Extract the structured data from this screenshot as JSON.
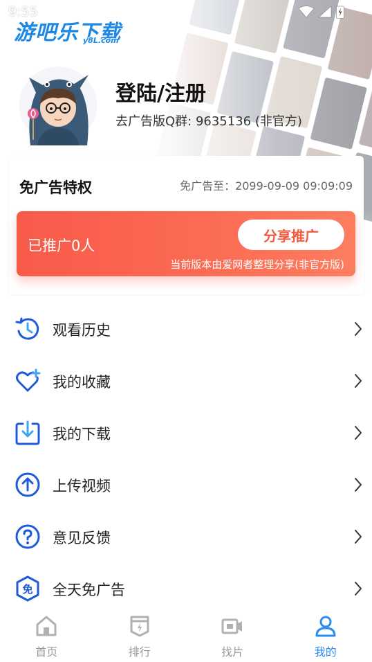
{
  "status_bar": {
    "time": "9:55"
  },
  "watermark": {
    "title": "游吧乐下载",
    "subtitle": "y8L.com"
  },
  "profile": {
    "title": "登陆/注册",
    "subtitle": "去广告版Q群: 9635136 (非官方)"
  },
  "vip": {
    "title": "免广告特权",
    "expire": "免广告至：2099-09-09 09:09:09",
    "promo_count": "已推广0人",
    "share_button": "分享推广",
    "promo_note": "当前版本由爱网者整理分享(非官方版)"
  },
  "menu": {
    "items": [
      {
        "label": "观看历史",
        "icon": "history-icon"
      },
      {
        "label": "我的收藏",
        "icon": "favorite-heart-icon"
      },
      {
        "label": "我的下载",
        "icon": "download-icon"
      },
      {
        "label": "上传视频",
        "icon": "upload-icon"
      },
      {
        "label": "意见反馈",
        "icon": "help-question-icon"
      },
      {
        "label": "全天免广告",
        "icon": "ad-free-badge-icon"
      }
    ]
  },
  "tabs": {
    "items": [
      {
        "label": "首页",
        "icon": "home-icon",
        "active": false
      },
      {
        "label": "排行",
        "icon": "ranking-icon",
        "active": false
      },
      {
        "label": "找片",
        "icon": "video-camera-icon",
        "active": false
      },
      {
        "label": "我的",
        "icon": "user-icon",
        "active": true
      }
    ]
  },
  "colors": {
    "accent_blue": "#2a8df0",
    "icon_blue": "#1e5bd8",
    "promo_red": "#f85a4a",
    "share_text": "#f25a3f"
  }
}
